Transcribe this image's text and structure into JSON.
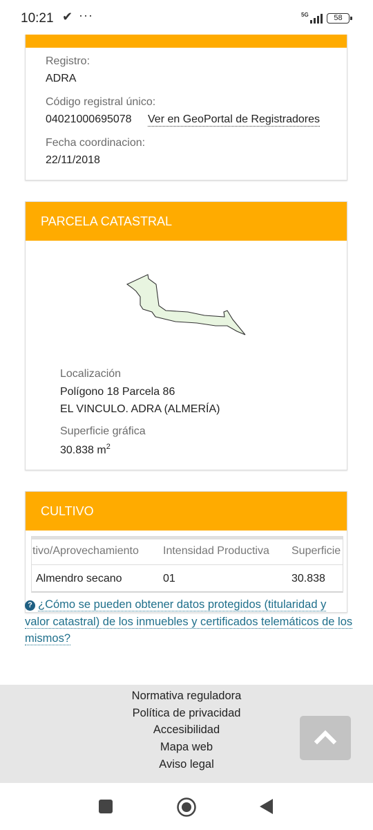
{
  "status_bar": {
    "time": "10:21",
    "network": "5G",
    "battery": "58"
  },
  "registro_card": {
    "registro_label": "Registro:",
    "registro_value": "ADRA",
    "codigo_label": "Código registral único:",
    "codigo_value": "04021000695078",
    "geoportal_link": "Ver en GeoPortal de Registradores",
    "fecha_label": "Fecha coordinacion:",
    "fecha_value": "22/11/2018"
  },
  "parcela_card": {
    "title": "PARCELA CATASTRAL",
    "localizacion_label": "Localización",
    "localizacion_line1": "Polígono 18 Parcela 86",
    "localizacion_line2": "EL VINCULO. ADRA (ALMERÍA)",
    "superficie_label": "Superficie gráfica",
    "superficie_value": "30.838 m",
    "superficie_unit_exp": "2"
  },
  "cultivo_card": {
    "title": "CULTIVO",
    "columns": [
      "tivo/Aprovechamiento",
      "Intensidad Productiva",
      "Superficie"
    ],
    "rows": [
      [
        "Almendro secano",
        "01",
        "30.838"
      ]
    ]
  },
  "help": {
    "text": "¿Cómo se pueden obtener datos protegidos (titularidad y valor catastral) de los inmuebles y certificados telemáticos de los mismos?"
  },
  "footer": {
    "links": [
      "Normativa reguladora",
      "Política de privacidad",
      "Accesibilidad",
      "Mapa web",
      "Aviso legal"
    ]
  },
  "colors": {
    "accent": "#ffab00",
    "link": "#1f6f8b",
    "parcel_fill": "#e8f5e0"
  }
}
